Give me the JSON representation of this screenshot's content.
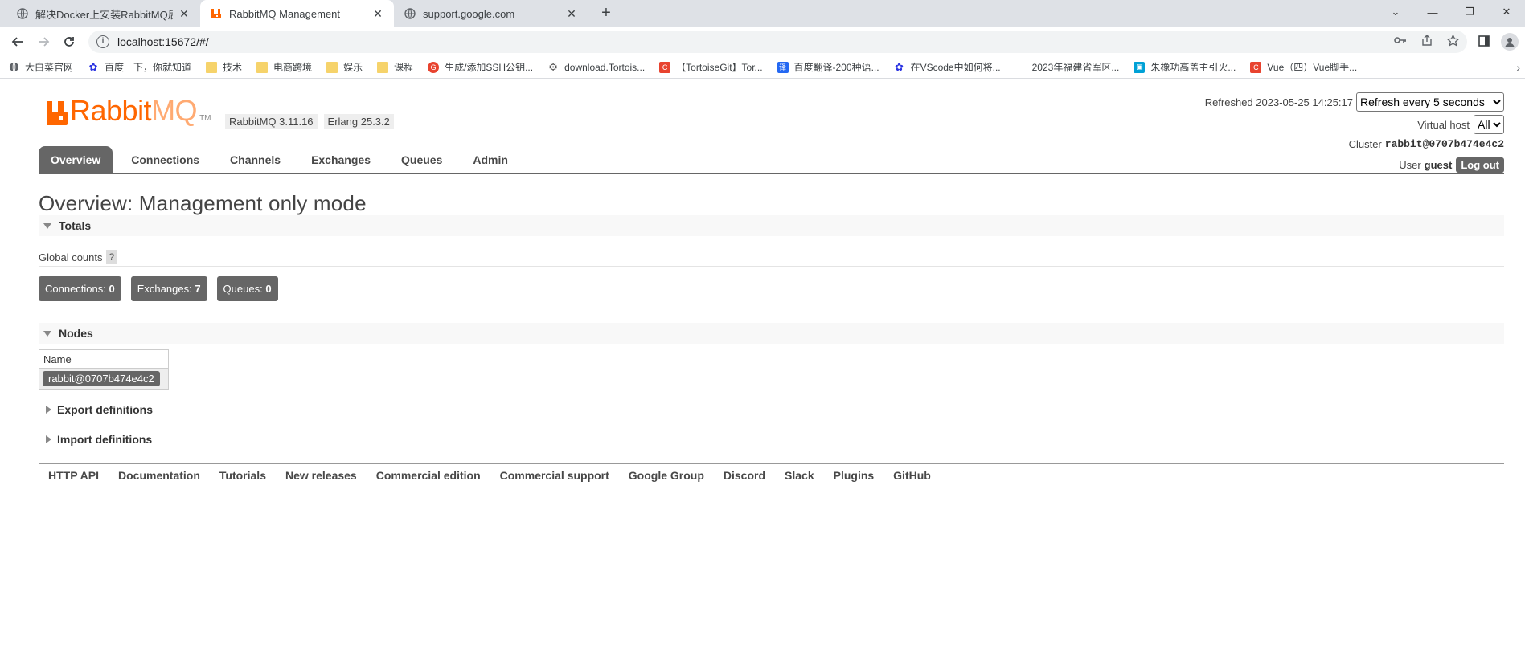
{
  "browser": {
    "tabs": [
      {
        "title": "解决Docker上安装RabbitMQ后",
        "active": false
      },
      {
        "title": "RabbitMQ Management",
        "active": true
      },
      {
        "title": "support.google.com",
        "active": false
      }
    ],
    "new_tab": "+",
    "window_controls": [
      "⌄",
      "—",
      "❐",
      "✕"
    ],
    "url": "localhost:15672/#/",
    "bookmarks": [
      {
        "label": "大白菜官网",
        "icon": "globe-icon"
      },
      {
        "label": "百度一下，你就知道",
        "icon": "baidu-icon"
      },
      {
        "label": "技术",
        "icon": "folder-icon"
      },
      {
        "label": "电商跨境",
        "icon": "folder-icon"
      },
      {
        "label": "娱乐",
        "icon": "folder-icon"
      },
      {
        "label": "课程",
        "icon": "folder-icon"
      },
      {
        "label": "生成/添加SSH公钥...",
        "icon": "gitee-icon"
      },
      {
        "label": "download.Tortois...",
        "icon": "tortoise-icon"
      },
      {
        "label": "【TortoiseGit】Tor...",
        "icon": "csdn-icon"
      },
      {
        "label": "百度翻译-200种语...",
        "icon": "translate-icon"
      },
      {
        "label": "在VScode中如何将...",
        "icon": "baidu-icon"
      },
      {
        "label": "2023年福建省军区...",
        "icon": "blank-icon"
      },
      {
        "label": "朱橡功高盖主引火...",
        "icon": "bilibili-icon"
      },
      {
        "label": "Vue（四）Vue脚手...",
        "icon": "csdn-icon"
      }
    ]
  },
  "rabbit": {
    "logo_rabbit": "Rabbit",
    "logo_mq": "MQ",
    "logo_tm": "TM",
    "version": "RabbitMQ 3.11.16",
    "erlang": "Erlang 25.3.2",
    "refreshed_label": "Refreshed 2023-05-25 14:25:17",
    "refresh_option": "Refresh every 5 seconds",
    "vhost_label": "Virtual host",
    "vhost_option": "All",
    "cluster_label": "Cluster",
    "cluster_name": "rabbit@0707b474e4c2",
    "user_label": "User",
    "user_name": "guest",
    "logout": "Log out",
    "nav": [
      "Overview",
      "Connections",
      "Channels",
      "Exchanges",
      "Queues",
      "Admin"
    ],
    "page_title": "Overview: Management only mode",
    "totals_label": "Totals",
    "global_counts_label": "Global counts",
    "help": "?",
    "counts": [
      {
        "label": "Connections:",
        "value": "0"
      },
      {
        "label": "Exchanges:",
        "value": "7"
      },
      {
        "label": "Queues:",
        "value": "0"
      }
    ],
    "nodes_label": "Nodes",
    "nodes_col_name": "Name",
    "node_name": "rabbit@0707b474e4c2",
    "export_label": "Export definitions",
    "import_label": "Import definitions",
    "footer": [
      "HTTP API",
      "Documentation",
      "Tutorials",
      "New releases",
      "Commercial edition",
      "Commercial support",
      "Google Group",
      "Discord",
      "Slack",
      "Plugins",
      "GitHub"
    ]
  },
  "colors": {
    "brand_orange": "#ff6600",
    "tab_grey": "#666666"
  }
}
